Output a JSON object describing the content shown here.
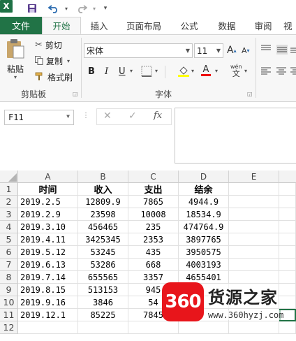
{
  "title_bar": {
    "app_icon_letter": "X"
  },
  "tabs": [
    "文件",
    "开始",
    "插入",
    "页面布局",
    "公式",
    "数据",
    "审阅",
    "视"
  ],
  "clipboard": {
    "paste": "粘贴",
    "cut": "剪切",
    "copy": "复制",
    "format_painter": "格式刷",
    "group_label": "剪贴板"
  },
  "font": {
    "name": "宋体",
    "size": "11",
    "group_label": "字体",
    "phonetic": "wén"
  },
  "formula_bar": {
    "name_box": "F11",
    "fx": "fx"
  },
  "columns": [
    "A",
    "B",
    "C",
    "D",
    "E"
  ],
  "rows": [
    "1",
    "2",
    "3",
    "4",
    "5",
    "6",
    "7",
    "8",
    "9",
    "10",
    "11",
    "12"
  ],
  "sheet": {
    "headers": [
      "时间",
      "收入",
      "支出",
      "结余"
    ],
    "data": [
      [
        "2019.2.5",
        "12809.9",
        "7865",
        "4944.9"
      ],
      [
        "2019.2.9",
        "23598",
        "10008",
        "18534.9"
      ],
      [
        "2019.3.10",
        "456465",
        "235",
        "474764.9"
      ],
      [
        "2019.4.11",
        "3425345",
        "2353",
        "3897765"
      ],
      [
        "2019.5.12",
        "53245",
        "435",
        "3950575"
      ],
      [
        "2019.6.13",
        "53286",
        "668",
        "4003193"
      ],
      [
        "2019.7.14",
        "655565",
        "3357",
        "4655401"
      ],
      [
        "2019.8.15",
        "513153",
        "945",
        ""
      ],
      [
        "2019.9.16",
        "3846",
        "54",
        ""
      ],
      [
        "2019.12.1",
        "85225",
        "7845",
        ""
      ]
    ]
  },
  "watermark": {
    "logo": "360",
    "brand": "货源之家",
    "url": "www.360hyzj.com"
  },
  "colors": {
    "excel_green": "#217346",
    "watermark_red": "#e8151b"
  }
}
